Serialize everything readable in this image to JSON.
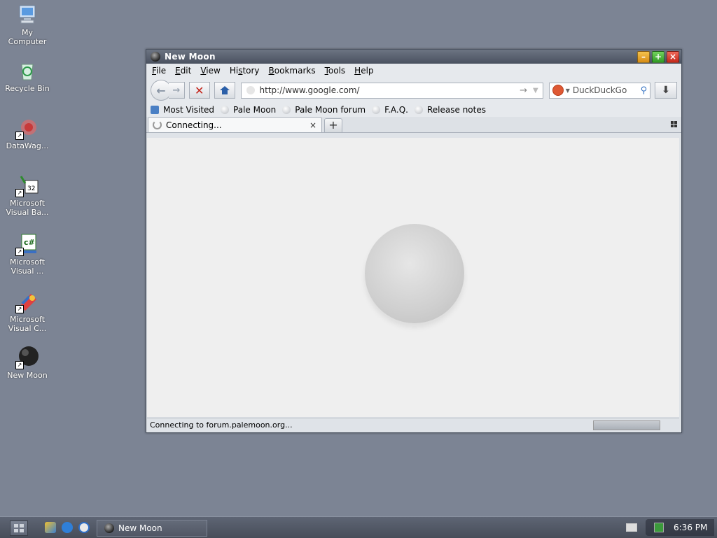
{
  "desktop": {
    "icons": [
      {
        "label": "My\nComputer"
      },
      {
        "label": "Recycle Bin"
      },
      {
        "label": "DataWag..."
      },
      {
        "label": "Microsoft\nVisual Ba..."
      },
      {
        "label": "Microsoft\nVisual ..."
      },
      {
        "label": "Microsoft\nVisual C..."
      },
      {
        "label": "New Moon"
      }
    ]
  },
  "window": {
    "title": "New Moon",
    "menu": [
      "File",
      "Edit",
      "View",
      "History",
      "Bookmarks",
      "Tools",
      "Help"
    ],
    "url": "http://www.google.com/",
    "search_engine": "DuckDuckGo",
    "bookmarks": [
      "Most Visited",
      "Pale Moon",
      "Pale Moon forum",
      "F.A.Q.",
      "Release notes"
    ],
    "tab": {
      "title": "Connecting...",
      "close": "×"
    },
    "new_tab": "+",
    "status": "Connecting to forum.palemoon.org..."
  },
  "taskbar": {
    "task_label": "New Moon",
    "clock": "6:36 PM"
  },
  "icons": {
    "back": "←",
    "forward": "→",
    "stop": "✕",
    "go": "→",
    "dropdown": "▼",
    "search": "⚲",
    "download": "⬇",
    "minimize": "–",
    "maximize": "+",
    "close": "×"
  }
}
